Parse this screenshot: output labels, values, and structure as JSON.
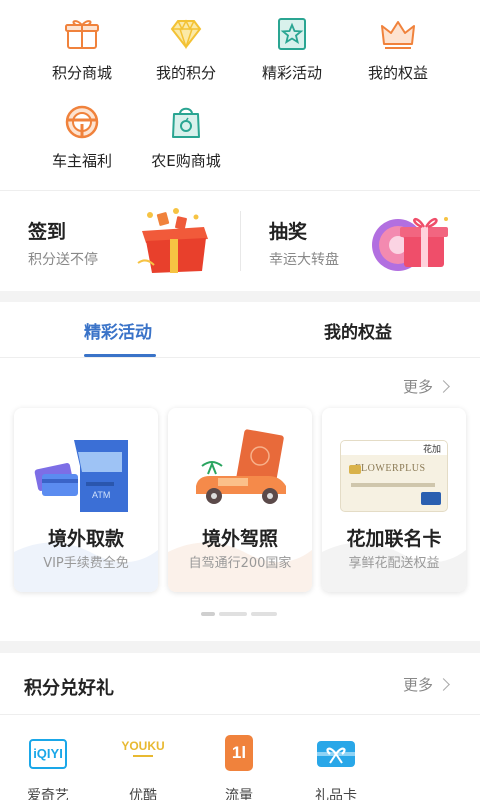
{
  "grid": {
    "items": [
      {
        "label": "积分商城",
        "icon": "gift-icon"
      },
      {
        "label": "我的积分",
        "icon": "diamond-icon"
      },
      {
        "label": "精彩活动",
        "icon": "star-badge-icon"
      },
      {
        "label": "我的权益",
        "icon": "crown-icon"
      },
      {
        "label": "车主福利",
        "icon": "steering-wheel-icon"
      },
      {
        "label": "农E购商城",
        "icon": "shopping-bag-icon"
      }
    ]
  },
  "promo": {
    "signin": {
      "title": "签到",
      "subtitle": "积分送不停"
    },
    "lottery": {
      "title": "抽奖",
      "subtitle": "幸运大转盘"
    }
  },
  "tabs": [
    {
      "label": "精彩活动",
      "active": true
    },
    {
      "label": "我的权益",
      "active": false
    }
  ],
  "more_label": "更多",
  "cards": [
    {
      "title": "境外取款",
      "subtitle": "VIP手续费全免"
    },
    {
      "title": "境外驾照",
      "subtitle": "自驾通行200国家"
    },
    {
      "title": "花加联名卡",
      "subtitle": "享鲜花配送权益",
      "card_brand": "花加",
      "card_text": "FLOWERPLUS"
    }
  ],
  "pager": {
    "count": 3,
    "active": 0
  },
  "points_section": {
    "title": "积分兑好礼",
    "more_label": "更多",
    "partners": [
      {
        "label": "爱奇艺",
        "logo_text": "iQIYI"
      },
      {
        "label": "优酷",
        "logo_text": "YOUKU"
      },
      {
        "label": "流量",
        "logo_text": "1l"
      },
      {
        "label": "礼品卡",
        "logo_text": ""
      }
    ]
  },
  "colors": {
    "accent": "#3a73c8",
    "orange": "#f0823c",
    "gold": "#f3c234",
    "teal": "#2aa592"
  }
}
